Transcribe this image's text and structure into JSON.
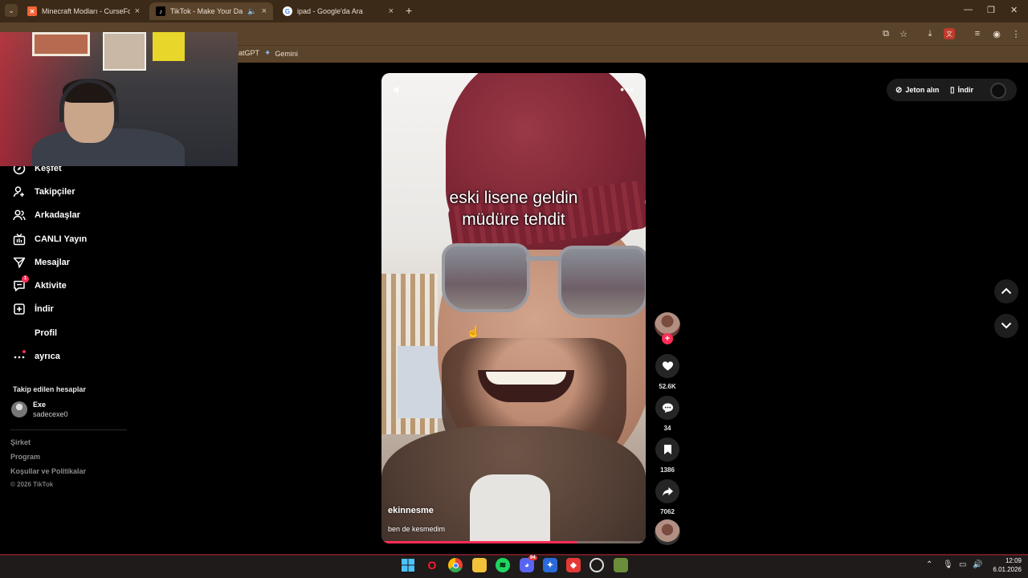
{
  "browser": {
    "tabs": [
      {
        "title": "Minecraft Modları - CurseForge",
        "favicon": "curseforge-icon",
        "active": false
      },
      {
        "title": "TikTok - Make Your Day",
        "favicon": "tiktok-icon",
        "active": true,
        "audio": true
      },
      {
        "title": "ipad - Google'da Ara",
        "favicon": "google-icon",
        "active": false
      }
    ],
    "bookmarks": [
      {
        "label": "atGPT"
      },
      {
        "label": "Gemini"
      }
    ]
  },
  "sidebar": {
    "items": [
      {
        "label": "Keşfet",
        "icon": "compass-icon"
      },
      {
        "label": "Takipçiler",
        "icon": "person-plus-icon"
      },
      {
        "label": "Arkadaşlar",
        "icon": "friends-icon"
      },
      {
        "label": "CANLI Yayın",
        "icon": "live-tv-icon"
      },
      {
        "label": "Mesajlar",
        "icon": "send-icon"
      },
      {
        "label": "Aktivite",
        "icon": "inbox-icon",
        "badge": "1"
      },
      {
        "label": "İndir",
        "icon": "plus-box-icon"
      },
      {
        "label": "Profil",
        "icon": "profile-icon"
      },
      {
        "label": "ayrıca",
        "icon": "more-dots-icon"
      }
    ],
    "following_title": "Takip edilen hesaplar",
    "following": [
      {
        "name": "Exe",
        "username": "sadecexe0"
      }
    ],
    "footer_links": [
      "Şirket",
      "Program",
      "Koşullar ve Politikalar"
    ],
    "copyright": "© 2026 TikTok"
  },
  "video": {
    "caption_line1": "eski lisene geldin",
    "caption_line2": "müdüre tehdit",
    "author": "ekinnesme",
    "description": "ben de kesmedim",
    "progress": 0.74
  },
  "actions": {
    "likes": "52.6K",
    "comments": "34",
    "saves": "1386",
    "shares": "7062"
  },
  "top_right": {
    "coins_label": "Jeton alın",
    "download_label": "İndir"
  },
  "taskbar": {
    "time": "12:09",
    "date": "6.01.2026",
    "chrome_badge": "94"
  },
  "colors": {
    "accent": "#fe2c55",
    "browser_frame": "#5a432b"
  }
}
